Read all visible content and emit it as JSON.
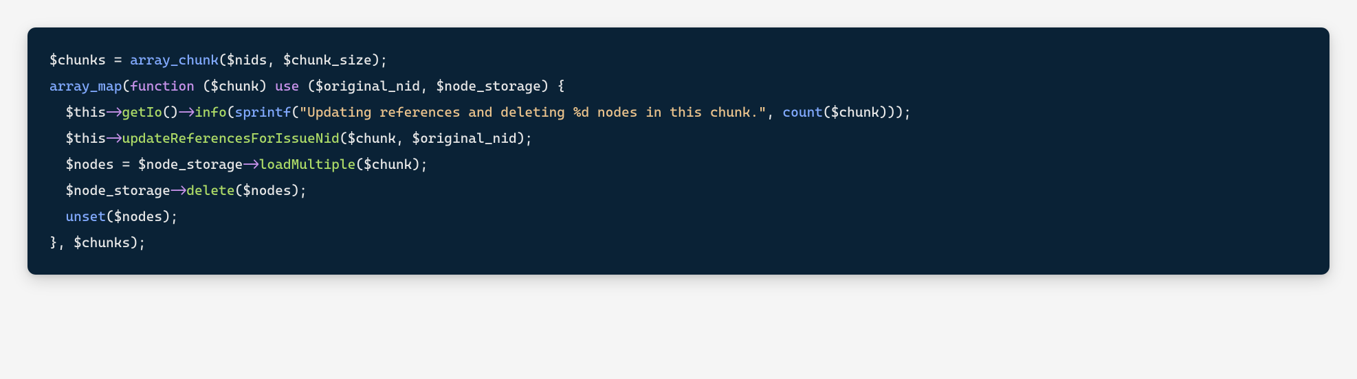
{
  "code": {
    "line1": {
      "var_chunks": "$chunks",
      "assign": " = ",
      "fn_array_chunk": "array_chunk",
      "lp": "(",
      "var_nids": "$nids",
      "comma1": ", ",
      "var_chunk_size": "$chunk_size",
      "rp_semi": ");"
    },
    "line2": {
      "fn_array_map": "array_map",
      "lp": "(",
      "kw_function": "function",
      "sp1": " ",
      "lp2": "(",
      "var_chunk": "$chunk",
      "rp2": ")",
      "sp2": " ",
      "kw_use": "use",
      "sp3": " ",
      "lp3": "(",
      "var_orig": "$original_nid",
      "comma": ", ",
      "var_ns": "$node_storage",
      "rp3": ")",
      "sp4": " ",
      "brace": "{"
    },
    "line3": {
      "indent": "  ",
      "var_this": "$this",
      "arrow1": "->",
      "m_getio": "getIo",
      "call1": "()",
      "arrow2": "->",
      "m_info": "info",
      "lp": "(",
      "fn_sprintf": "sprintf",
      "lp2": "(",
      "str": "\"Updating references and deleting %d nodes in this chunk.\"",
      "comma": ", ",
      "fn_count": "count",
      "lp3": "(",
      "var_chunk": "$chunk",
      "close": ")));"
    },
    "line4": {
      "indent": "  ",
      "var_this": "$this",
      "arrow": "->",
      "m_update": "updateReferencesForIssueNid",
      "lp": "(",
      "var_chunk": "$chunk",
      "comma": ", ",
      "var_orig": "$original_nid",
      "close": ");"
    },
    "line5": {
      "indent": "  ",
      "var_nodes": "$nodes",
      "assign": " = ",
      "var_ns": "$node_storage",
      "arrow": "->",
      "m_load": "loadMultiple",
      "lp": "(",
      "var_chunk": "$chunk",
      "close": ");"
    },
    "line6": {
      "indent": "  ",
      "var_ns": "$node_storage",
      "arrow": "->",
      "m_delete": "delete",
      "lp": "(",
      "var_nodes": "$nodes",
      "close": ");"
    },
    "line7": {
      "indent": "  ",
      "fn_unset": "unset",
      "lp": "(",
      "var_nodes": "$nodes",
      "close": ");"
    },
    "line8": {
      "brace": "}",
      "comma": ", ",
      "var_chunks": "$chunks",
      "close": ");"
    }
  }
}
